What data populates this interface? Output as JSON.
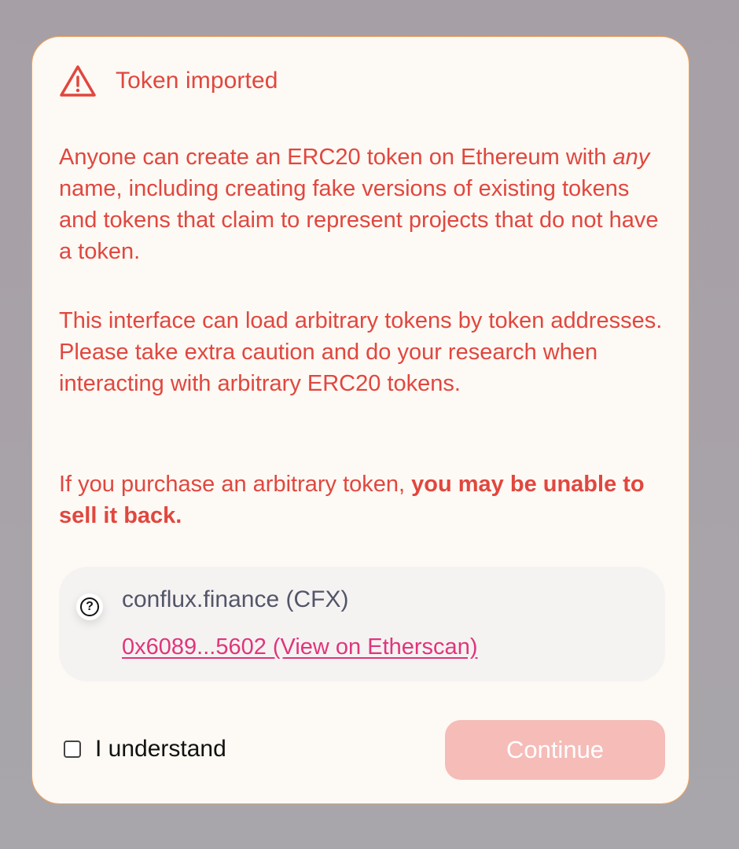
{
  "modal": {
    "icon": "warning-triangle-icon",
    "title": "Token imported",
    "paragraph1_a": "Anyone can create an ERC20 token on Ethereum with ",
    "paragraph1_em": "any",
    "paragraph1_b": " name, including creating fake versions of existing tokens and tokens that claim to represent projects that do not have a token.",
    "paragraph2": "This interface can load arbitrary tokens by token addresses. Please take extra caution and do your research when interacting with arbitrary ERC20 tokens.",
    "paragraph3_a": "If you purchase an arbitrary token, ",
    "paragraph3_strong": "you may be unable to sell it back.",
    "colors": {
      "warning": "#e0473f",
      "border": "#f0a25c",
      "link": "#e0357c",
      "button_disabled": "#f5bcb8"
    }
  },
  "token": {
    "icon": "question-circle-icon",
    "name": "conflux.finance (CFX)",
    "link_text": "0x6089...5602 (View on Etherscan)"
  },
  "footer": {
    "checkbox_label": "I understand",
    "checkbox_checked": false,
    "continue_label": "Continue",
    "continue_disabled": true
  }
}
